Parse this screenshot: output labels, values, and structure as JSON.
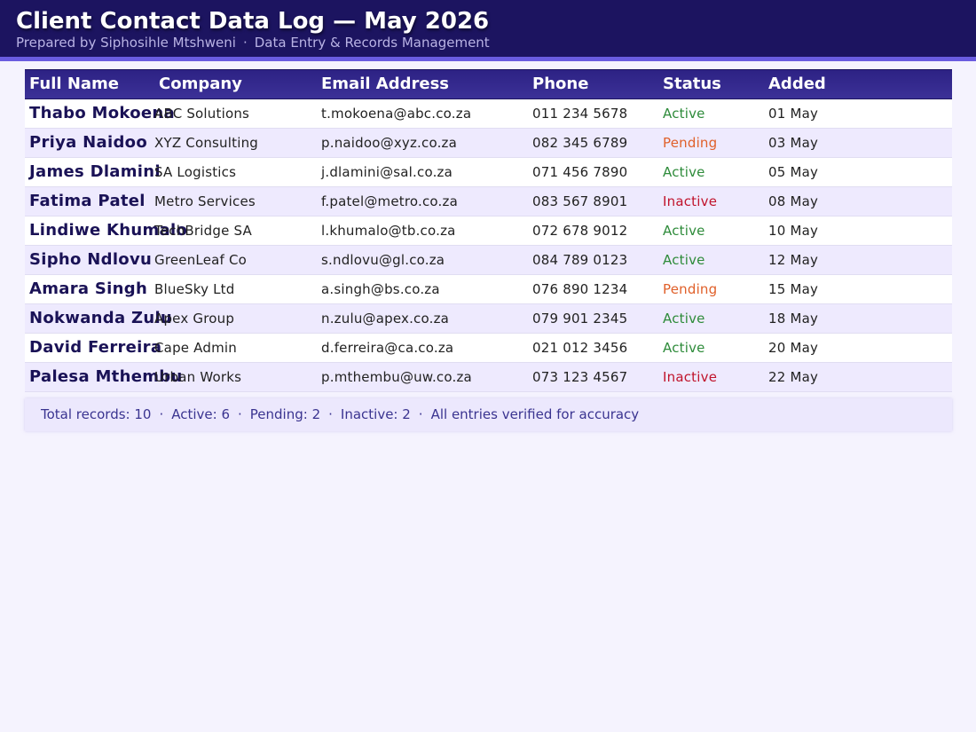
{
  "header": {
    "title": "Client Contact Data Log — May 2026",
    "author": "Prepared by Siphosihle Mtshweni",
    "separator": "·",
    "department": "Data Entry & Records Management"
  },
  "table": {
    "columns": [
      "Full Name",
      "Company",
      "Email Address",
      "Phone",
      "Status",
      "Added"
    ],
    "rows": [
      {
        "name": "Thabo Mokoena",
        "company": "ABC Solutions",
        "email": "t.mokoena@abc.co.za",
        "phone": "011 234 5678",
        "status": "Active",
        "added": "01 May"
      },
      {
        "name": "Priya Naidoo",
        "company": "XYZ Consulting",
        "email": "p.naidoo@xyz.co.za",
        "phone": "082 345 6789",
        "status": "Pending",
        "added": "03 May"
      },
      {
        "name": "James Dlamini",
        "company": "SA Logistics",
        "email": "j.dlamini@sal.co.za",
        "phone": "071 456 7890",
        "status": "Active",
        "added": "05 May"
      },
      {
        "name": "Fatima Patel",
        "company": "Metro Services",
        "email": "f.patel@metro.co.za",
        "phone": "083 567 8901",
        "status": "Inactive",
        "added": "08 May"
      },
      {
        "name": "Lindiwe Khumalo",
        "company": "TechBridge SA",
        "email": "l.khumalo@tb.co.za",
        "phone": "072 678 9012",
        "status": "Active",
        "added": "10 May"
      },
      {
        "name": "Sipho Ndlovu",
        "company": "GreenLeaf Co",
        "email": "s.ndlovu@gl.co.za",
        "phone": "084 789 0123",
        "status": "Active",
        "added": "12 May"
      },
      {
        "name": "Amara Singh",
        "company": "BlueSky Ltd",
        "email": "a.singh@bs.co.za",
        "phone": "076 890 1234",
        "status": "Pending",
        "added": "15 May"
      },
      {
        "name": "Nokwanda Zulu",
        "company": "Apex Group",
        "email": "n.zulu@apex.co.za",
        "phone": "079 901 2345",
        "status": "Active",
        "added": "18 May"
      },
      {
        "name": "David Ferreira",
        "company": "Cape Admin",
        "email": "d.ferreira@ca.co.za",
        "phone": "021 012 3456",
        "status": "Active",
        "added": "20 May"
      },
      {
        "name": "Palesa Mthembu",
        "company": "Urban Works",
        "email": "p.mthembu@uw.co.za",
        "phone": "073 123 4567",
        "status": "Inactive",
        "added": "22 May"
      }
    ]
  },
  "footer": {
    "items": [
      "Total records: 10",
      "Active: 6",
      "Pending: 2",
      "Inactive: 2",
      "All entries verified for accuracy"
    ],
    "separator": "·"
  },
  "colors": {
    "header_bg": "#1c1460",
    "accent": "#6a5ce0",
    "status_active": "#2e8b3a",
    "status_pending": "#e0602a",
    "status_inactive": "#c0142c"
  }
}
